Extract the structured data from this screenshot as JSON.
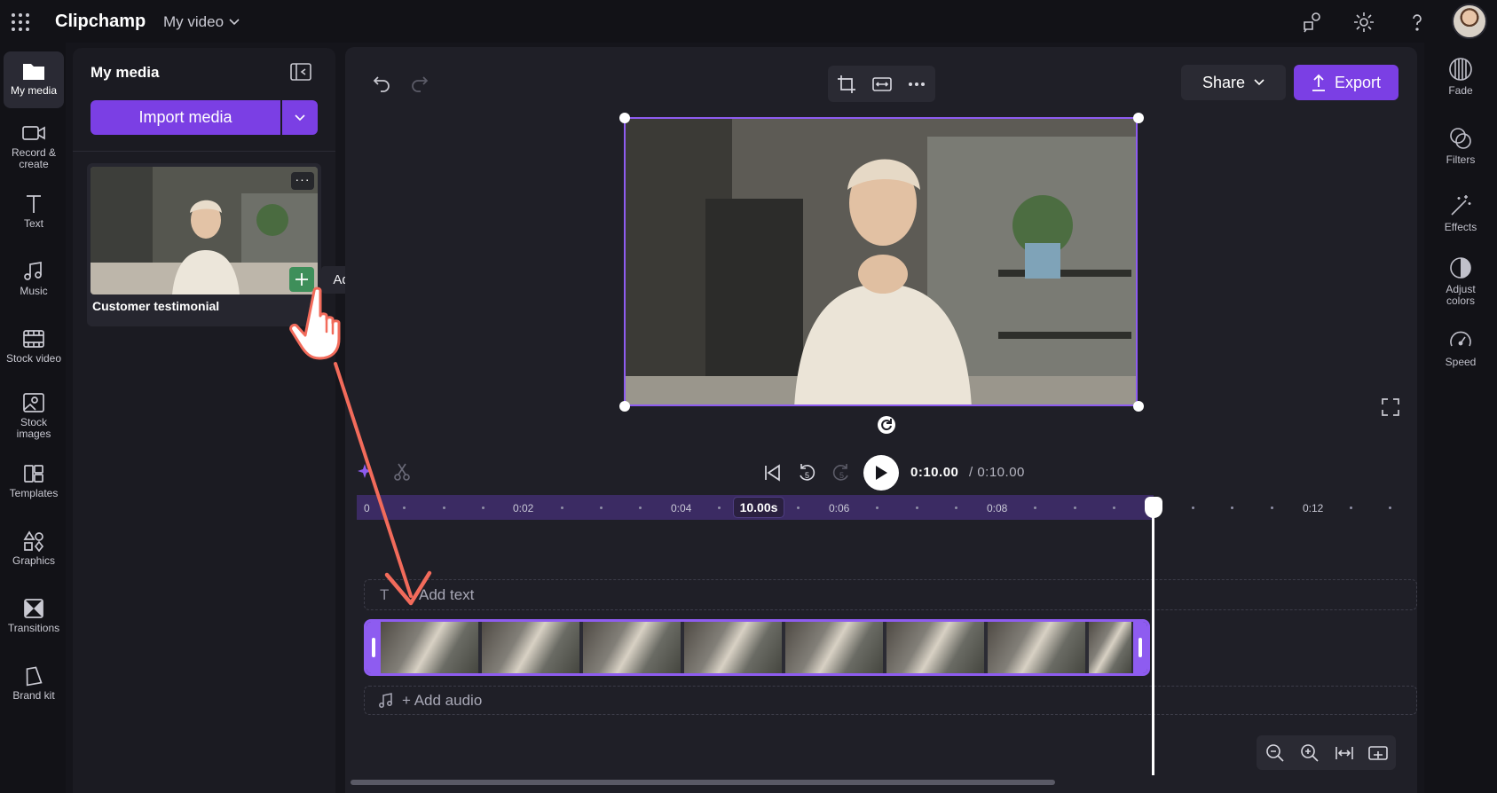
{
  "app": {
    "name": "Clipchamp",
    "video_title": "My video"
  },
  "left_nav": [
    {
      "label": "My media",
      "icon": "folder-icon"
    },
    {
      "label": "Record &\ncreate",
      "icon": "camera-icon"
    },
    {
      "label": "Text",
      "icon": "text-icon"
    },
    {
      "label": "Music",
      "icon": "music-icon"
    },
    {
      "label": "Stock video",
      "icon": "film-icon"
    },
    {
      "label": "Stock\nimages",
      "icon": "image-icon"
    },
    {
      "label": "Templates",
      "icon": "templates-icon"
    },
    {
      "label": "Graphics",
      "icon": "shapes-icon"
    },
    {
      "label": "Transitions",
      "icon": "transitions-icon"
    },
    {
      "label": "Brand kit",
      "icon": "brand-icon"
    }
  ],
  "media_panel": {
    "title": "My media",
    "import_label": "Import media",
    "media_item": {
      "name": "Customer testimonial",
      "more": "···"
    },
    "tooltip": "Add to timeline"
  },
  "editor": {
    "share_label": "Share",
    "export_label": "Export",
    "time_current": "0:10.00",
    "time_total": "/ 0:10.00",
    "playhead_badge": "10.00s",
    "ruler_labels": [
      "0",
      "0:02",
      "0:04",
      "0:06",
      "0:08",
      "0:12"
    ],
    "add_text": "Add text",
    "add_audio": "+ Add audio",
    "rewind_seconds": "5",
    "forward_seconds": "5"
  },
  "right_panel": [
    {
      "label": "Fade",
      "icon": "fade-icon"
    },
    {
      "label": "Filters",
      "icon": "filters-icon"
    },
    {
      "label": "Effects",
      "icon": "effects-icon"
    },
    {
      "label": "Adjust\ncolors",
      "icon": "adjust-colors-icon"
    },
    {
      "label": "Speed",
      "icon": "speed-icon"
    }
  ],
  "colors": {
    "accent": "#7b3fe4",
    "selection": "#8e5cf0",
    "annotation": "#f26b5b"
  }
}
